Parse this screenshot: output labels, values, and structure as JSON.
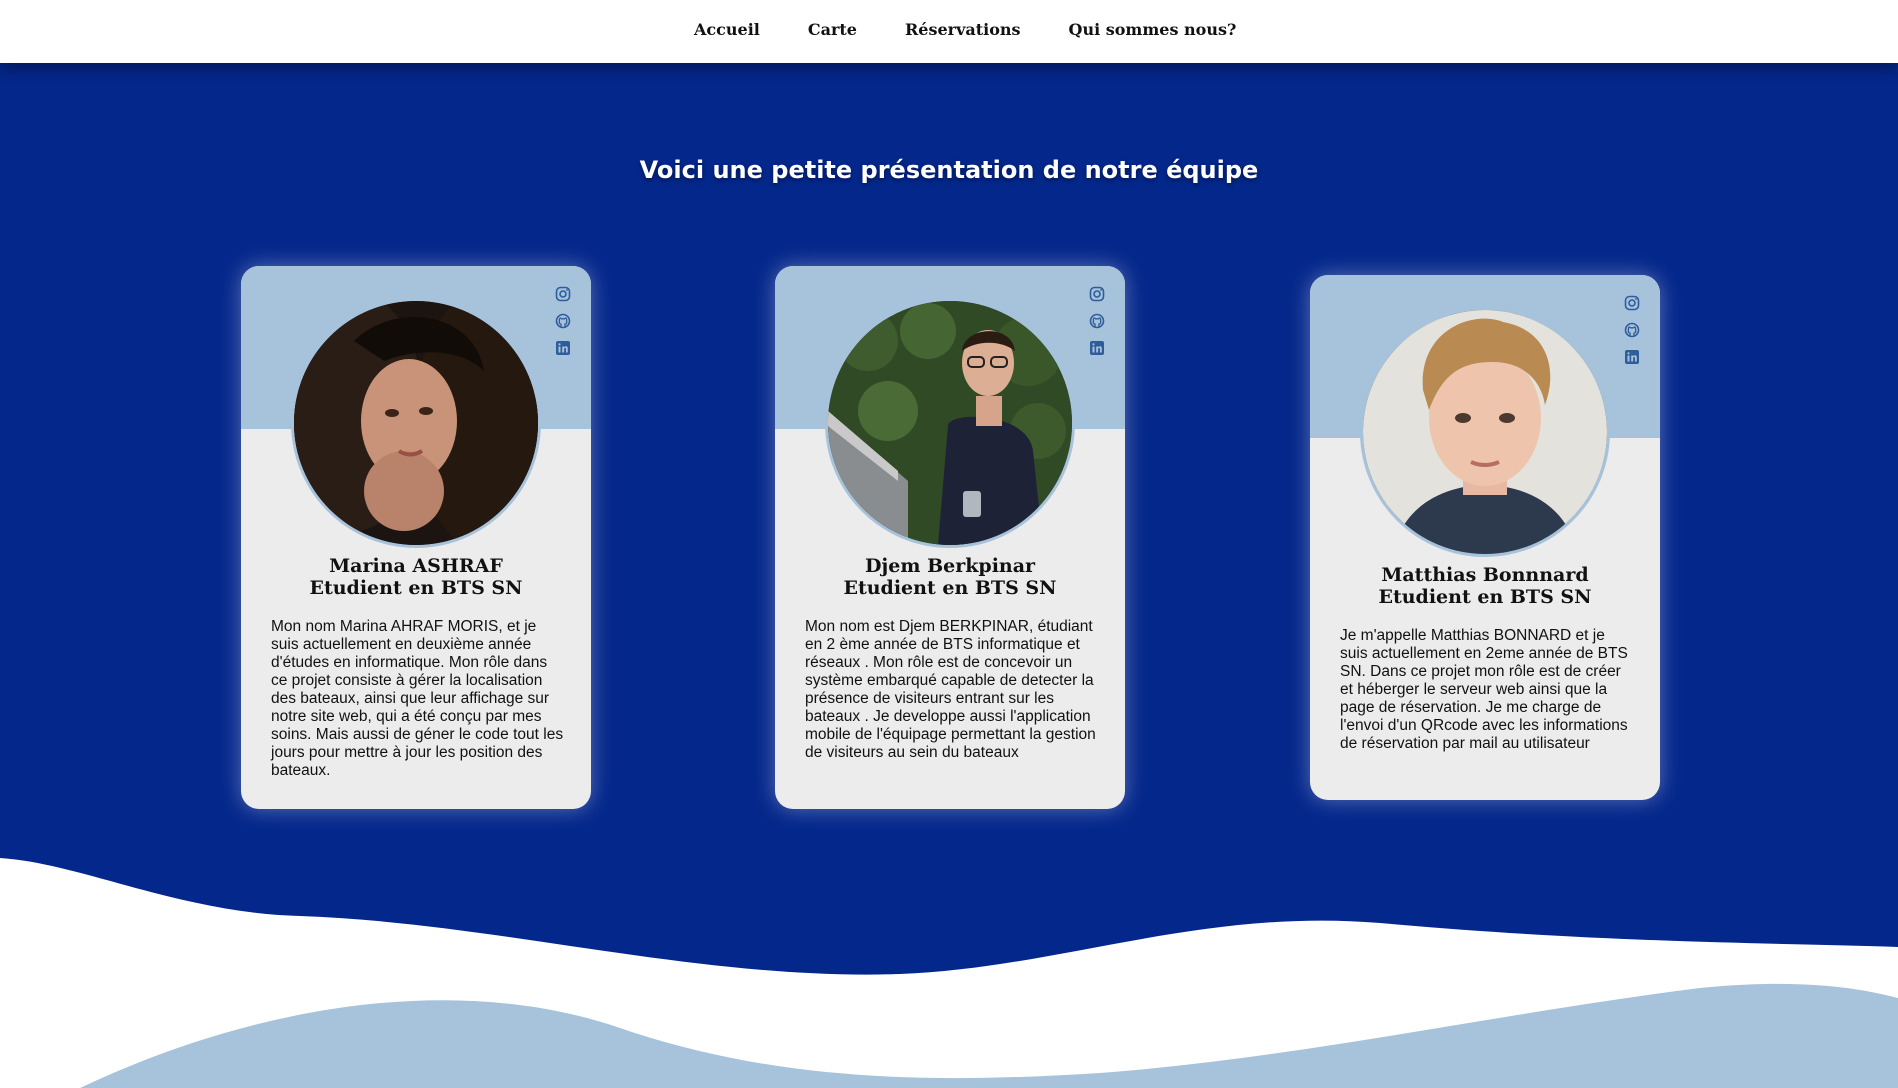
{
  "nav": {
    "items": [
      "Accueil",
      "Carte",
      "Réservations",
      "Qui sommes nous?"
    ]
  },
  "hero": {
    "title": "Voici une petite présentation de notre équipe"
  },
  "colors": {
    "primary": "#04278b",
    "accent": "#a7c2db",
    "card": "#ececec"
  },
  "team": [
    {
      "name": "Marina ASHRAF",
      "role": "Etudient en BTS SN",
      "description": "Mon nom Marina AHRAF MORIS, et je suis actuellement en deuxième année d'études en informatique. Mon rôle dans ce projet consiste à gérer la localisation des bateaux, ainsi que leur affichage sur notre site web, qui a été conçu par mes soins. Mais aussi de géner le code tout les jours pour mettre à jour les position des bateaux.",
      "socials": [
        "instagram-icon",
        "github-icon",
        "linkedin-icon"
      ]
    },
    {
      "name": "Djem Berkpinar",
      "role": "Etudient en BTS SN",
      "description": "Mon nom est Djem BERKPINAR, étudiant en 2 ème année de BTS informatique et réseaux . Mon rôle est de concevoir un système embarqué capable de detecter la présence de visiteurs entrant sur les bateaux . Je developpe aussi l'application mobile de l'équipage permettant la gestion de visiteurs au sein du bateaux",
      "socials": [
        "instagram-icon",
        "github-icon",
        "linkedin-icon"
      ]
    },
    {
      "name": "Matthias Bonnnard",
      "role": "Etudient en BTS SN",
      "description": "Je m'appelle Matthias BONNARD et je suis actuellement en 2eme année de BTS SN. Dans ce projet mon rôle est de créer et héberger le serveur web ainsi que la page de réservation. Je me charge de l'envoi d'un QRcode avec les informations de réservation par mail au utilisateur",
      "socials": [
        "instagram-icon",
        "github-icon",
        "linkedin-icon"
      ]
    }
  ]
}
